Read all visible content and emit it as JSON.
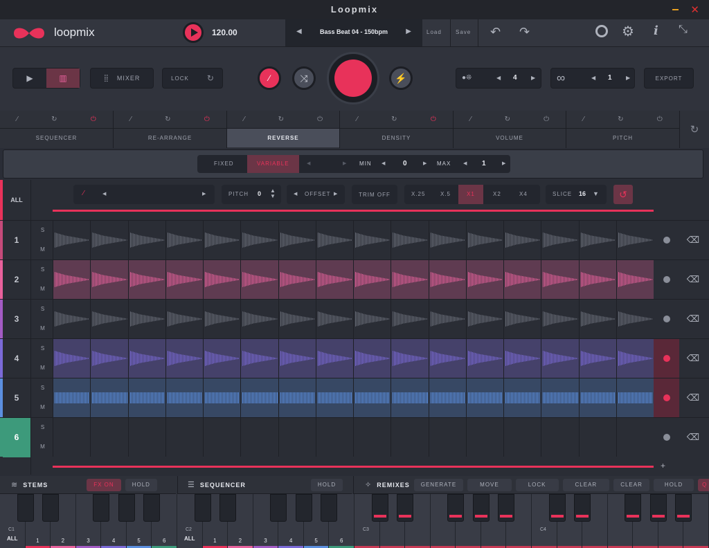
{
  "window": {
    "title": "Loopmix"
  },
  "header": {
    "logo": "loopmix",
    "tempo": "120.00",
    "preset": "Bass Beat 04 - 150bpm",
    "load": "Load",
    "save": "Save"
  },
  "controls": {
    "mixer": "MIXER",
    "lock": "LOCK",
    "stepper1": "4",
    "stepper2": "1",
    "export": "EXPORT"
  },
  "fx": {
    "tabs": [
      "SEQUENCER",
      "RE-ARRANGE",
      "REVERSE",
      "DENSITY",
      "VOLUME",
      "PITCH"
    ]
  },
  "options": {
    "fixed": "FIXED",
    "variable": "VARIABLE",
    "min_label": "MIN",
    "min_value": "0",
    "max_label": "MAX",
    "max_value": "1"
  },
  "slicebar": {
    "all": "ALL",
    "pitch_label": "PITCH",
    "pitch_value": "0",
    "offset": "OFFSET",
    "trim": "TRIM OFF",
    "rates": [
      "X.25",
      "X.5",
      "X1",
      "X2",
      "X4"
    ],
    "slice_label": "SLICE",
    "slice_value": "16"
  },
  "tracks": [
    {
      "n": "1"
    },
    {
      "n": "2"
    },
    {
      "n": "3"
    },
    {
      "n": "4"
    },
    {
      "n": "5"
    },
    {
      "n": "6"
    }
  ],
  "sm": {
    "s": "S",
    "m": "M"
  },
  "bottom": {
    "stems": "STEMS",
    "fx_on": "FX ON",
    "hold": "HOLD",
    "sequencer": "SEQUENCER",
    "seq_hold": "HOLD",
    "remixes": "REMIXES",
    "generate": "GENERATE",
    "move": "MOVE",
    "lock": "LOCK",
    "clear": "CLEAR",
    "clear_all": "CLEAR ALL",
    "rhold": "HOLD",
    "q": "Q"
  },
  "keyboard": {
    "c1": "C1",
    "c2": "C2",
    "c3": "C3",
    "c4": "C4",
    "all": "ALL",
    "keys": [
      "1",
      "2",
      "3",
      "4",
      "5",
      "6"
    ]
  },
  "colors": {
    "accent": "#e8325a",
    "pink": "#e8619c",
    "purple": "#7b6ad8",
    "blue": "#5b8fe0",
    "green": "#3d9a7b",
    "track1": "#c54a7a",
    "track3": "#a35bc4"
  }
}
